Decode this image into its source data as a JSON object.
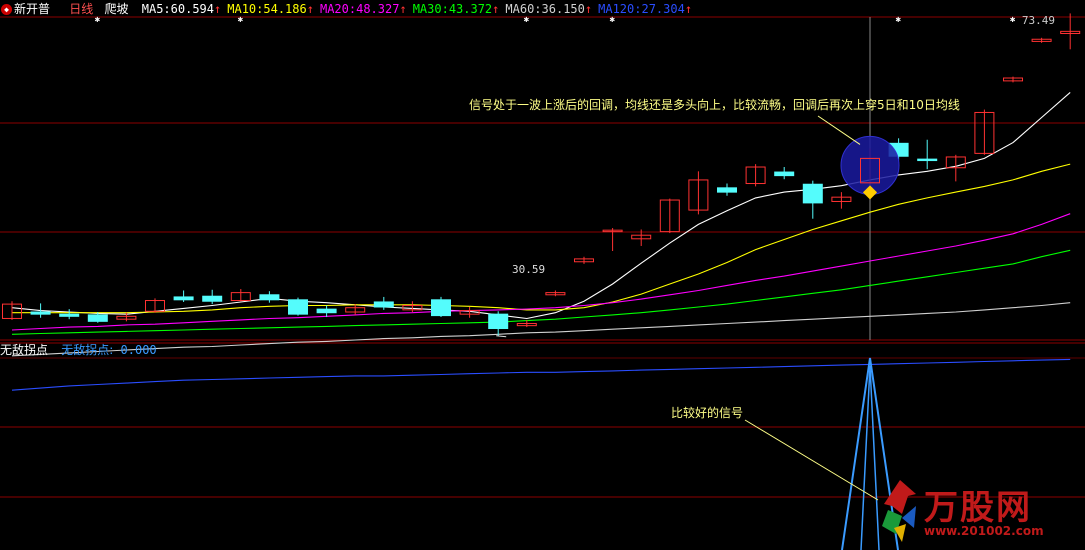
{
  "header": {
    "stock_name": "新开普",
    "period": "日线",
    "formula": "爬坡",
    "ma": [
      {
        "label": "MA5:",
        "value": "60.594",
        "arrow": "↑",
        "color": "#ffffff"
      },
      {
        "label": "MA10:",
        "value": "54.186",
        "arrow": "↑",
        "color": "#ffff00"
      },
      {
        "label": "MA20:",
        "value": "48.327",
        "arrow": "↑",
        "color": "#ff00ff"
      },
      {
        "label": "MA30:",
        "value": "43.372",
        "arrow": "↑",
        "color": "#00ff00"
      },
      {
        "label": "MA60:",
        "value": "36.150",
        "arrow": "↑",
        "color": "#d0d0d0"
      },
      {
        "label": "MA120:",
        "value": "27.304",
        "arrow": "↑",
        "color": "#2a4dff"
      }
    ],
    "price_high": "73.49"
  },
  "sub_header": {
    "name": "无敌拐点",
    "line_label": "无敌拐点:",
    "line_value": "0.000"
  },
  "annotations": {
    "main_note": "信号处于一波上涨后的回调，均线还是多头向上，比较流畅，回调后再次上穿5日和10日均线",
    "low_label": "30.59",
    "sub_note": "比较好的信号"
  },
  "watermark": {
    "brand": "万股网",
    "url": "www.201002.com"
  },
  "colors": {
    "up": "#ff3232",
    "down": "#54fcfc",
    "grid": "#8b0000",
    "signal_line": "#3a9bff"
  },
  "chart_data": {
    "type": "candlestick",
    "ylim": [
      30,
      75
    ],
    "candles": [
      {
        "o": 33.0,
        "c": 35.0,
        "h": 35.4,
        "l": 32.8
      },
      {
        "o": 33.9,
        "c": 33.6,
        "h": 35.1,
        "l": 33.1
      },
      {
        "o": 33.6,
        "c": 33.3,
        "h": 34.3,
        "l": 32.9
      },
      {
        "o": 33.5,
        "c": 32.6,
        "h": 33.9,
        "l": 32.4
      },
      {
        "o": 32.9,
        "c": 33.3,
        "h": 33.8,
        "l": 32.6
      },
      {
        "o": 34.0,
        "c": 35.5,
        "h": 35.8,
        "l": 33.8
      },
      {
        "o": 36.0,
        "c": 35.6,
        "h": 36.9,
        "l": 35.3
      },
      {
        "o": 36.1,
        "c": 35.4,
        "h": 37.0,
        "l": 35.0
      },
      {
        "o": 35.5,
        "c": 36.6,
        "h": 37.1,
        "l": 35.4
      },
      {
        "o": 36.3,
        "c": 35.6,
        "h": 36.8,
        "l": 35.2
      },
      {
        "o": 35.6,
        "c": 33.6,
        "h": 35.9,
        "l": 33.4
      },
      {
        "o": 34.3,
        "c": 33.8,
        "h": 34.8,
        "l": 33.2
      },
      {
        "o": 33.9,
        "c": 34.5,
        "h": 35.0,
        "l": 33.5
      },
      {
        "o": 35.3,
        "c": 34.6,
        "h": 36.0,
        "l": 34.2
      },
      {
        "o": 34.2,
        "c": 34.8,
        "h": 35.4,
        "l": 33.9
      },
      {
        "o": 35.6,
        "c": 33.4,
        "h": 36.0,
        "l": 33.2
      },
      {
        "o": 33.6,
        "c": 34.1,
        "h": 34.6,
        "l": 33.1
      },
      {
        "o": 33.6,
        "c": 31.6,
        "h": 34.0,
        "l": 30.59
      },
      {
        "o": 32.0,
        "c": 32.3,
        "h": 32.8,
        "l": 31.8
      },
      {
        "o": 36.3,
        "c": 36.6,
        "h": 36.9,
        "l": 36.1
      },
      {
        "o": 40.9,
        "c": 41.3,
        "h": 41.6,
        "l": 40.6
      },
      {
        "o": 45.1,
        "c": 45.3,
        "h": 45.6,
        "l": 42.4
      },
      {
        "o": 44.1,
        "c": 44.6,
        "h": 45.4,
        "l": 43.1
      },
      {
        "o": 45.1,
        "c": 49.5,
        "h": 49.7,
        "l": 44.9
      },
      {
        "o": 48.1,
        "c": 52.3,
        "h": 53.5,
        "l": 47.5
      },
      {
        "o": 51.2,
        "c": 50.6,
        "h": 51.8,
        "l": 50.1
      },
      {
        "o": 51.8,
        "c": 54.1,
        "h": 54.5,
        "l": 51.4
      },
      {
        "o": 53.4,
        "c": 52.9,
        "h": 54.1,
        "l": 52.4
      },
      {
        "o": 51.7,
        "c": 49.1,
        "h": 52.2,
        "l": 46.9
      },
      {
        "o": 49.3,
        "c": 49.9,
        "h": 50.6,
        "l": 48.3
      },
      {
        "o": 51.9,
        "c": 55.3,
        "h": 56.7,
        "l": 50.7
      },
      {
        "o": 57.4,
        "c": 55.6,
        "h": 58.1,
        "l": 55.0
      },
      {
        "o": 55.2,
        "c": 55.0,
        "h": 57.9,
        "l": 53.8
      },
      {
        "o": 54.0,
        "c": 55.5,
        "h": 55.8,
        "l": 52.1
      },
      {
        "o": 56.0,
        "c": 61.7,
        "h": 62.1,
        "l": 55.8
      },
      {
        "o": 66.1,
        "c": 66.5,
        "h": 66.7,
        "l": 65.9
      },
      {
        "o": 71.6,
        "c": 71.9,
        "h": 72.1,
        "l": 71.4
      },
      {
        "o": 72.7,
        "c": 73.0,
        "h": 75.5,
        "l": 70.5
      }
    ],
    "ma5": [
      34.5,
      34.1,
      33.9,
      33.7,
      33.6,
      34.0,
      34.4,
      34.8,
      35.3,
      35.8,
      35.4,
      35.2,
      34.9,
      34.6,
      34.4,
      34.2,
      34.0,
      33.5,
      33.0,
      33.8,
      35.4,
      37.8,
      40.7,
      43.5,
      46.1,
      48.0,
      49.8,
      50.6,
      51.0,
      51.5,
      52.3,
      53.0,
      53.5,
      54.2,
      55.3,
      57.5,
      61.0,
      64.5
    ],
    "ma10": [
      33.8,
      33.8,
      33.8,
      33.8,
      33.8,
      33.9,
      34.0,
      34.2,
      34.5,
      34.7,
      34.8,
      34.8,
      34.9,
      34.9,
      34.9,
      34.8,
      34.7,
      34.5,
      34.2,
      34.2,
      34.5,
      35.3,
      36.4,
      37.8,
      39.2,
      40.8,
      42.6,
      44.0,
      45.4,
      46.6,
      47.8,
      48.9,
      49.8,
      50.6,
      51.4,
      52.3,
      53.5,
      54.5
    ],
    "ma20": [
      31.4,
      31.6,
      31.8,
      31.9,
      32.1,
      32.2,
      32.4,
      32.6,
      32.8,
      33.0,
      33.1,
      33.3,
      33.5,
      33.7,
      33.8,
      34.0,
      34.1,
      34.2,
      34.3,
      34.5,
      34.8,
      35.2,
      35.7,
      36.3,
      36.9,
      37.6,
      38.3,
      38.9,
      39.6,
      40.3,
      41.0,
      41.7,
      42.4,
      43.1,
      43.9,
      44.8,
      46.1,
      47.6
    ],
    "ma30": [
      30.8,
      30.9,
      31.0,
      31.1,
      31.2,
      31.3,
      31.4,
      31.5,
      31.6,
      31.7,
      31.8,
      31.9,
      32.0,
      32.1,
      32.2,
      32.3,
      32.4,
      32.5,
      32.7,
      32.9,
      33.2,
      33.5,
      33.8,
      34.2,
      34.6,
      35.0,
      35.5,
      36.0,
      36.5,
      37.0,
      37.6,
      38.2,
      38.8,
      39.4,
      40.0,
      40.6,
      41.6,
      42.5
    ],
    "ma60": [
      27.8,
      28.0,
      28.2,
      28.4,
      28.6,
      28.8,
      29.0,
      29.1,
      29.3,
      29.5,
      29.7,
      29.8,
      30.0,
      30.2,
      30.3,
      30.5,
      30.6,
      30.8,
      31.0,
      31.1,
      31.3,
      31.5,
      31.7,
      31.9,
      32.1,
      32.3,
      32.5,
      32.7,
      32.9,
      33.1,
      33.3,
      33.5,
      33.7,
      33.9,
      34.2,
      34.5,
      34.8,
      35.2
    ],
    "ma120": [
      23.0,
      23.3,
      23.6,
      23.8,
      24.0,
      24.2,
      24.4,
      24.5,
      24.6,
      24.7,
      24.8,
      24.9,
      25.0,
      25.0,
      25.1,
      25.2,
      25.3,
      25.4,
      25.5,
      25.5,
      25.6,
      25.7,
      25.8,
      25.9,
      26.0,
      26.1,
      26.2,
      26.3,
      26.4,
      26.5,
      26.6,
      26.7,
      26.8,
      26.9,
      27.0,
      27.1,
      27.2,
      27.3
    ],
    "signal": {
      "index": 30,
      "value": 1
    }
  }
}
